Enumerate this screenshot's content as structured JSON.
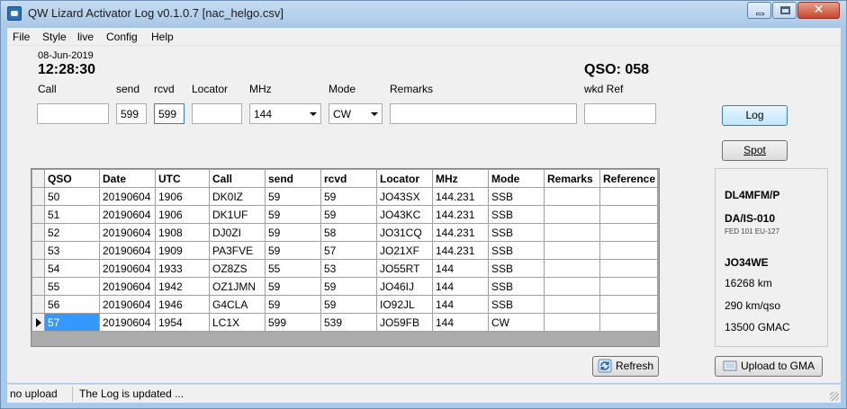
{
  "window": {
    "title": "QW Lizard Activator Log v0.1.0.7 [nac_helgo.csv]",
    "close_glyph": "✕"
  },
  "menu": [
    "File",
    "Style",
    "live",
    "Config",
    "Help"
  ],
  "header": {
    "date": "08-Jun-2019",
    "time": "12:28:30",
    "qso_count": "QSO: 058"
  },
  "form": {
    "labels": {
      "call": "Call",
      "send": "send",
      "rcvd": "rcvd",
      "locator": "Locator",
      "mhz": "MHz",
      "mode": "Mode",
      "remarks": "Remarks",
      "wkd_ref": "wkd Ref"
    },
    "values": {
      "call": "",
      "send": "599",
      "rcvd": "599",
      "locator": "",
      "mhz": "144",
      "mode": "CW",
      "remarks": "",
      "wkd_ref": ""
    }
  },
  "buttons": {
    "log": "Log",
    "spot": "Spot",
    "refresh": "Refresh",
    "upload": "Upload to GMA"
  },
  "grid": {
    "columns": [
      "QSO",
      "Date",
      "UTC",
      "Call",
      "send",
      "rcvd",
      "Locator",
      "MHz",
      "Mode",
      "Remarks",
      "Reference"
    ],
    "rows": [
      [
        "50",
        "20190604",
        "1906",
        "DK0IZ",
        "59",
        "59",
        "JO43SX",
        "144.231",
        "SSB",
        "",
        ""
      ],
      [
        "51",
        "20190604",
        "1906",
        "DK1UF",
        "59",
        "59",
        "JO43KC",
        "144.231",
        "SSB",
        "",
        ""
      ],
      [
        "52",
        "20190604",
        "1908",
        "DJ0ZI",
        "59",
        "58",
        "JO31CQ",
        "144.231",
        "SSB",
        "",
        ""
      ],
      [
        "53",
        "20190604",
        "1909",
        "PA3FVE",
        "59",
        "57",
        "JO21XF",
        "144.231",
        "SSB",
        "",
        ""
      ],
      [
        "54",
        "20190604",
        "1933",
        "OZ8ZS",
        "55",
        "53",
        "JO55RT",
        "144",
        "SSB",
        "",
        ""
      ],
      [
        "55",
        "20190604",
        "1942",
        "OZ1JMN",
        "59",
        "59",
        "JO46IJ",
        "144",
        "SSB",
        "",
        ""
      ],
      [
        "56",
        "20190604",
        "1946",
        "G4CLA",
        "59",
        "59",
        "IO92JL",
        "144",
        "SSB",
        "",
        ""
      ],
      [
        "57",
        "20190604",
        "1954",
        "LC1X",
        "599",
        "539",
        "JO59FB",
        "144",
        "CW",
        "",
        ""
      ]
    ],
    "current_row": 7
  },
  "info": {
    "callsign": "DL4MFM/P",
    "reference": "DA/IS-010",
    "ref_extra": "FED 101 EU-127",
    "locator": "JO34WE",
    "distance": "16268 km",
    "per_qso": "290 km/qso",
    "gmac": "13500 GMAC"
  },
  "status": {
    "upload": "no upload",
    "message": "The Log is updated ..."
  }
}
